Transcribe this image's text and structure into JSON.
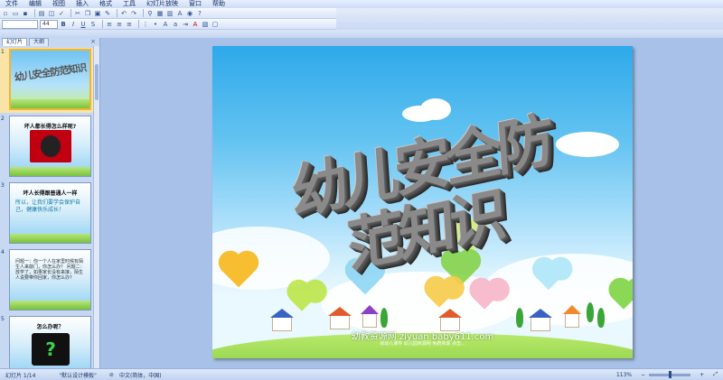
{
  "menubar": {
    "items": [
      "文件",
      "编辑",
      "视图",
      "插入",
      "格式",
      "工具",
      "幻灯片放映",
      "窗口",
      "帮助"
    ]
  },
  "toolbar1": {
    "icons": [
      "new-icon",
      "open-icon",
      "save-icon",
      "print-icon",
      "preview-icon",
      "spell-icon",
      "cut-icon",
      "copy-icon",
      "paste-icon",
      "format-painter-icon",
      "undo-icon",
      "redo-icon",
      "hyperlink-icon",
      "table-icon",
      "chart-icon",
      "textbox-icon",
      "zoom-icon",
      "help-icon"
    ]
  },
  "toolbar2": {
    "font_name": "",
    "font_size": "44",
    "labels": [
      "B",
      "I",
      "U",
      "S"
    ]
  },
  "left_pane": {
    "tabs": [
      "幻灯片",
      "大纲"
    ],
    "close": "×",
    "thumbnails": [
      {
        "num": "1",
        "title": "幼儿安全防范知识",
        "sub": ""
      },
      {
        "num": "2",
        "title": "坏人都长得怎么样呢?",
        "sub": ""
      },
      {
        "num": "3",
        "title": "坏人长得跟普通人一样",
        "sub": "所以，让我们要学会保护自己，健康快乐成长！"
      },
      {
        "num": "4",
        "title": "",
        "sub": "问题一：你一个人在家里时候有陌生人来敲门，你怎么办？ 问题二：放学了，如果家长没有来接，陌生人说要带你回家，你怎么办？"
      },
      {
        "num": "5",
        "title": "怎么办呢？",
        "sub": ""
      }
    ]
  },
  "slide": {
    "title": "幼儿安全防范知识",
    "watermark": "幼教资源网 ziyuan.baby611.com",
    "watermark_sub": "找幼儿课件 幼儿园资源网 免费资源 点击..."
  },
  "statusbar": {
    "slide_position": "幻灯片 1/14",
    "template": "\"默认设计模板\"",
    "language": "中文(简体，中国)",
    "zoom": "113%"
  }
}
